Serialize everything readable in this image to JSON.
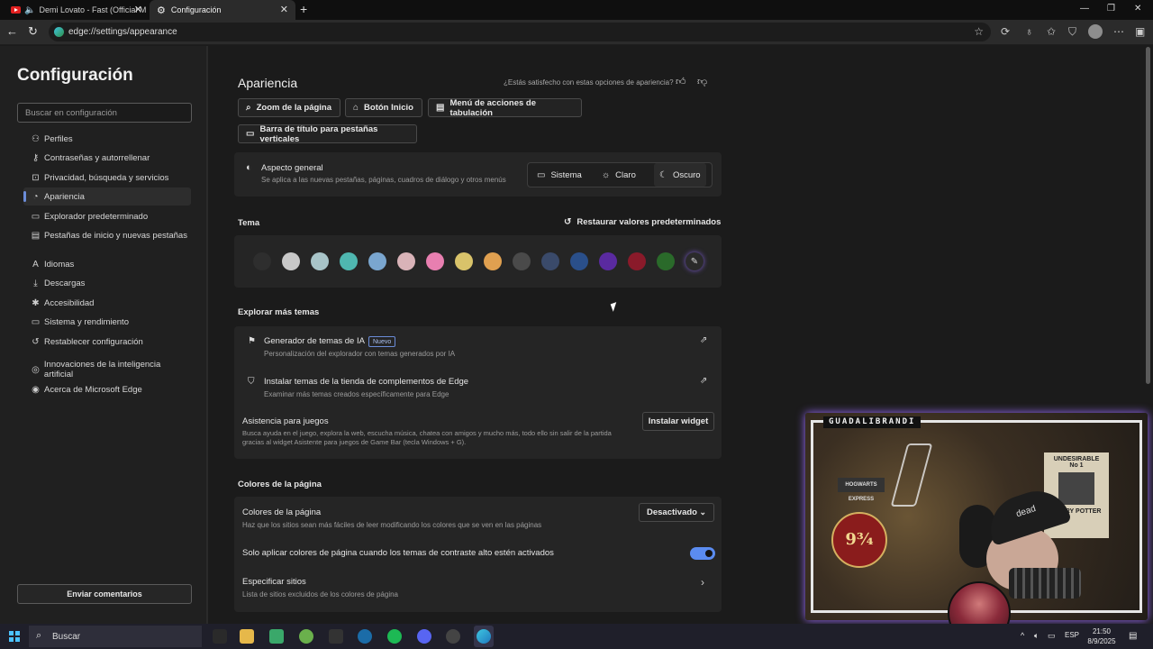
{
  "browser": {
    "tabs": [
      {
        "label": "Demi Lovato - Fast (Official M"
      },
      {
        "label": "Configuración"
      }
    ],
    "url": "edge://settings/appearance"
  },
  "sidebar": {
    "title": "Configuración",
    "search_placeholder": "Buscar en configuración",
    "items": [
      {
        "label": "Perfiles",
        "icon": "person-icon"
      },
      {
        "label": "Contraseñas y autorrellenar",
        "icon": "key-icon"
      },
      {
        "label": "Privacidad, búsqueda y servicios",
        "icon": "lock-icon"
      },
      {
        "label": "Apariencia",
        "icon": "palette-icon"
      },
      {
        "label": "Explorador predeterminado",
        "icon": "browser-icon"
      },
      {
        "label": "Pestañas de inicio y nuevas pestañas",
        "icon": "home-tabs-icon"
      },
      {
        "label": "Idiomas",
        "icon": "language-icon"
      },
      {
        "label": "Descargas",
        "icon": "download-icon"
      },
      {
        "label": "Accesibilidad",
        "icon": "accessibility-icon"
      },
      {
        "label": "Sistema y rendimiento",
        "icon": "laptop-icon"
      },
      {
        "label": "Restablecer configuración",
        "icon": "reset-icon"
      },
      {
        "label": "Innovaciones de la inteligencia artificial",
        "icon": "ai-icon"
      },
      {
        "label": "Acerca de Microsoft Edge",
        "icon": "edge-icon"
      }
    ],
    "feedback": "Enviar comentarios"
  },
  "main": {
    "title": "Apariencia",
    "satisfaction": "¿Estás satisfecho con estas opciones de apariencia?",
    "quick": {
      "zoom": "Zoom de la página",
      "home": "Botón Inicio",
      "tabmenu": "Menú de acciones de tabulación",
      "titlebar": "Barra de título para pestañas verticales"
    },
    "overall": {
      "title": "Aspecto general",
      "desc": "Se aplica a las nuevas pestañas, páginas, cuadros de diálogo y otros menús",
      "options": {
        "system": "Sistema",
        "light": "Claro",
        "dark": "Oscuro"
      },
      "selected": "Oscuro"
    },
    "theme": {
      "title": "Tema",
      "restore": "Restaurar valores predeterminados",
      "swatches": [
        "#2e2e2e",
        "#c8c8c8",
        "#a8c4c8",
        "#4fb7b0",
        "#7aa6cf",
        "#d9b3b8",
        "#e87fb0",
        "#d9c36a",
        "#e0a050",
        "#4a4a4a",
        "#3a4a6a",
        "#2a4f8a",
        "#5a2aa0",
        "#8a1a2a",
        "#2a6a2a"
      ]
    },
    "explore": {
      "title": "Explorar más temas",
      "ai_title": "Generador de temas de IA",
      "ai_badge": "Nuevo",
      "ai_desc": "Personalización del explorador con temas generados por IA",
      "store_title": "Instalar temas de la tienda de complementos de Edge",
      "store_desc": "Examinar más temas creados específicamente para Edge",
      "game_title": "Asistencia para juegos",
      "game_desc1": "Busca ayuda en el juego, explora la web, escucha música, chatea con amigos y mucho más, todo ello sin salir de la partida",
      "game_desc2": "gracias al widget Asistente para juegos de Game Bar (tecla Windows + G).",
      "game_button": "Instalar widget"
    },
    "page_colors": {
      "section": "Colores de la página",
      "title": "Colores de la página",
      "desc": "Haz que los sitios sean más fáciles de leer modificando los colores que se ven en las páginas",
      "dropdown": "Desactivado",
      "contrast_label": "Solo aplicar colores de página cuando los temas de contraste alto estén activados",
      "contrast_on": true,
      "sites_title": "Especificar sitios",
      "sites_desc": "Lista de sitios excluidos de los colores de página"
    }
  },
  "webcam": {
    "name": "GUADALIBRANDI",
    "poster_top": "UNDESIRABLE",
    "poster_no": "No 1",
    "poster_name": "HARRY POTTER",
    "platform": "9¾",
    "hogwarts": "HOGWARTS EXPRESS",
    "hat_text": "dead"
  },
  "taskbar": {
    "search": "Buscar",
    "lang": "ESP",
    "time": "21:50",
    "date": "8/9/2025"
  }
}
